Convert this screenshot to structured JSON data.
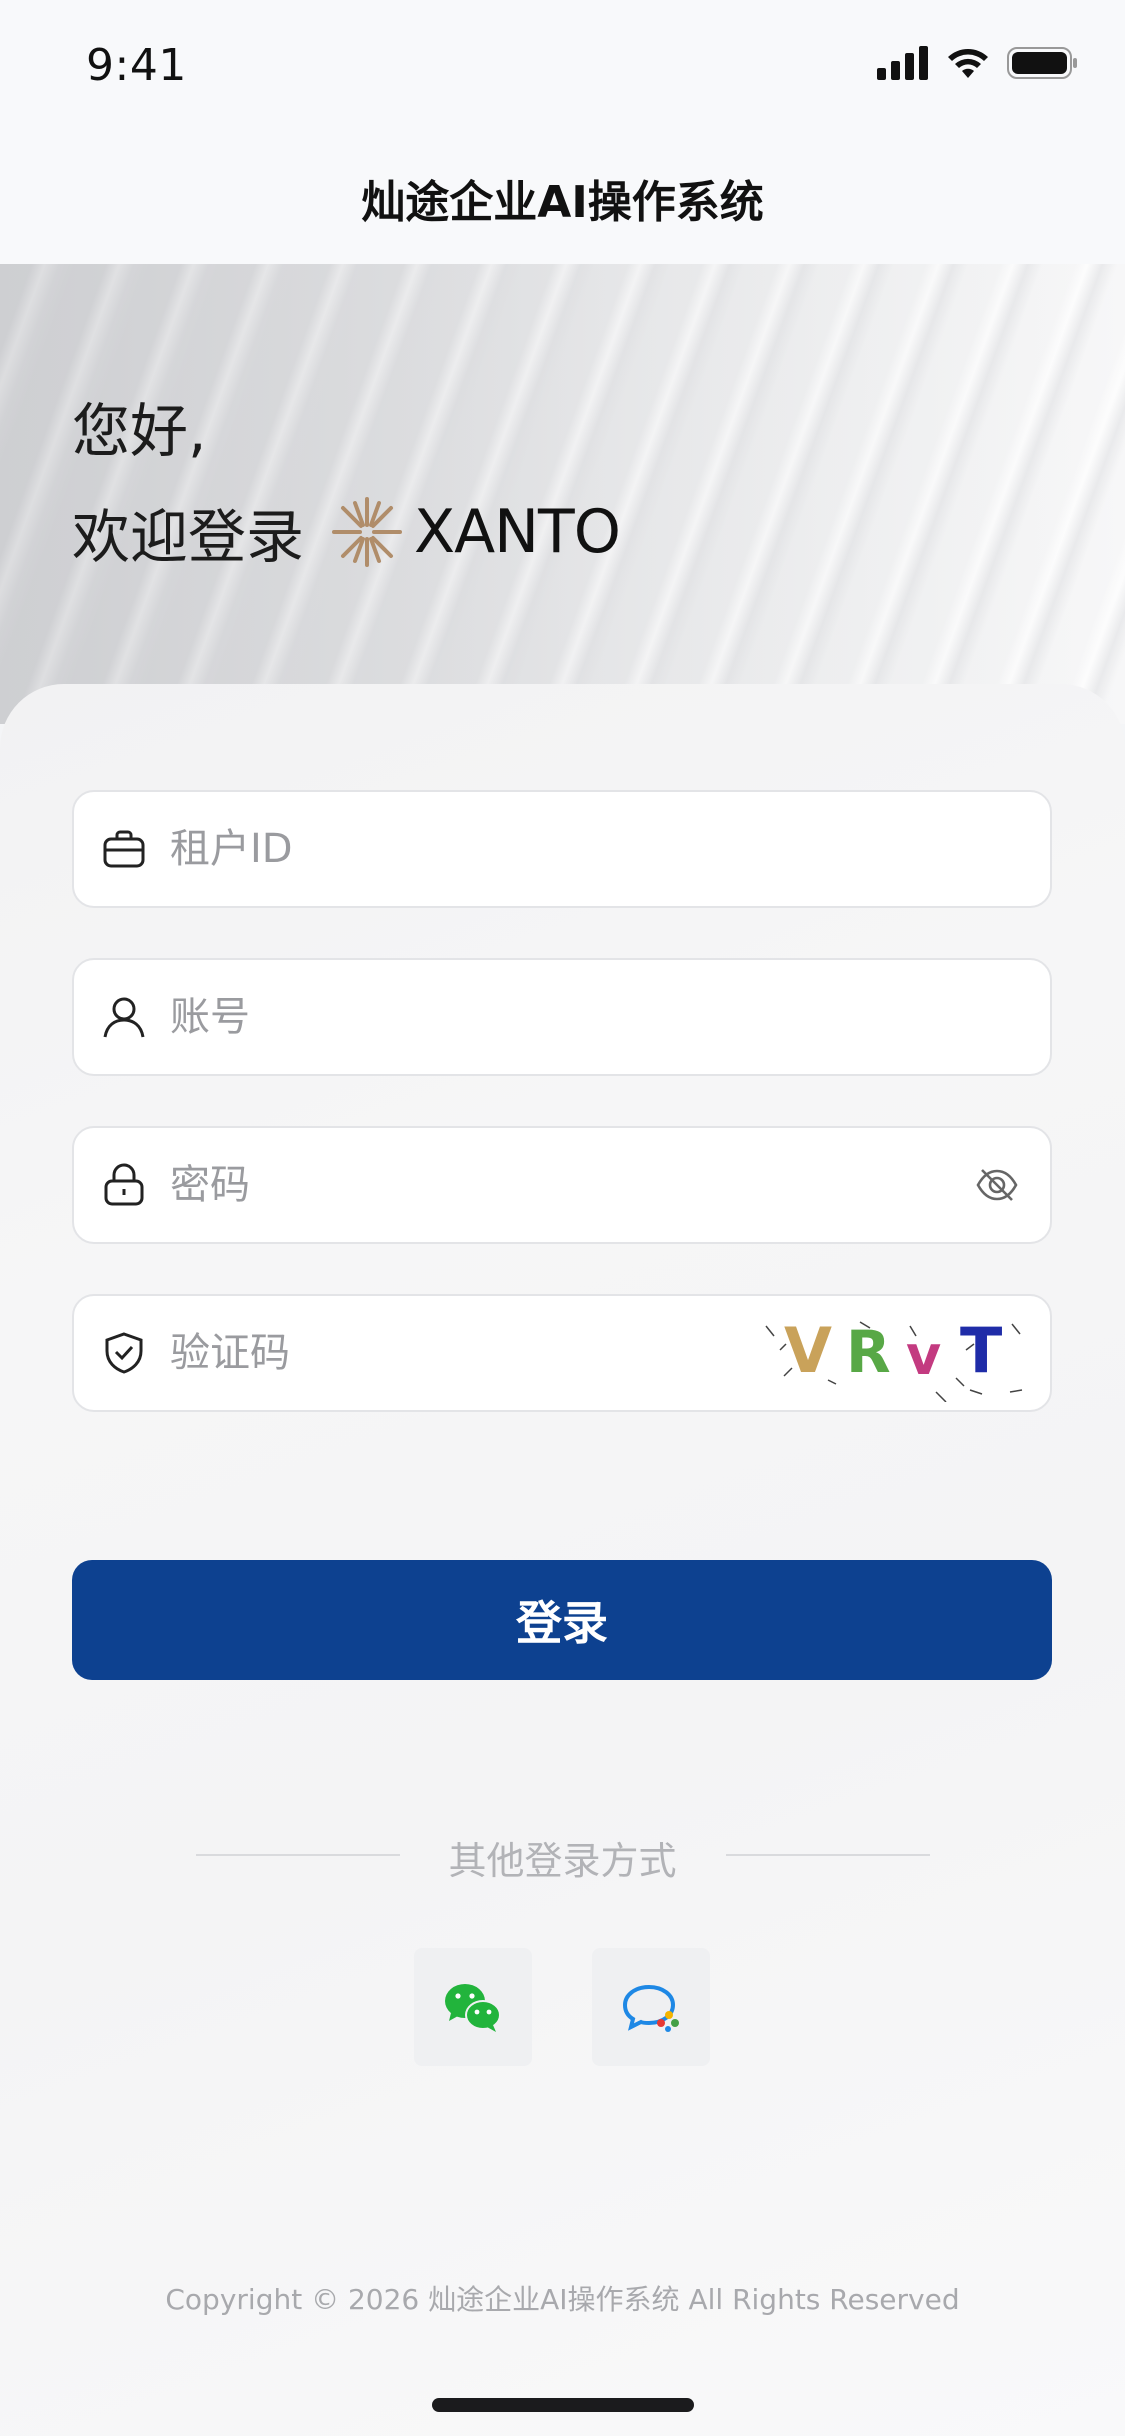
{
  "status_bar": {
    "time": "9:41"
  },
  "nav": {
    "title": "灿途企业AI操作系统"
  },
  "hero": {
    "greeting": "您好,",
    "welcome": "欢迎登录",
    "brand": "XANTO"
  },
  "form": {
    "tenant_placeholder": "租户ID",
    "account_placeholder": "账号",
    "password_placeholder": "密码",
    "captcha_placeholder": "验证码",
    "captcha_text": [
      "V",
      "R",
      "v",
      "T"
    ]
  },
  "login_button": "登录",
  "other_login": {
    "label": "其他登录方式",
    "methods": [
      "wechat-icon",
      "chat-icon"
    ]
  },
  "footer": {
    "copyright": "Copyright © 2026 灿途企业AI操作系统 All Rights Reserved"
  },
  "colors": {
    "primary": "#0d4190",
    "brand_gold": "#b08d6a",
    "wechat": "#22b43c"
  }
}
